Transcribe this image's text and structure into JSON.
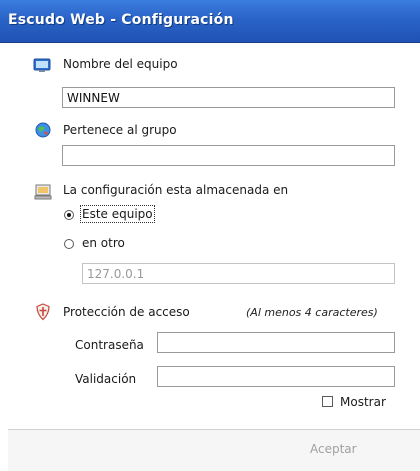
{
  "window": {
    "title": "Escudo Web - Configuración"
  },
  "computer": {
    "label": "Nombre del equipo",
    "value": "WINNEW",
    "icon": "computer-icon"
  },
  "group": {
    "label": "Pertenece al grupo",
    "value": "",
    "icon": "network-globe-icon"
  },
  "storage": {
    "label": "La configuración esta almacenada en",
    "icon": "desktop-monitor-icon",
    "options": [
      {
        "label": "Este equipo",
        "selected": true
      },
      {
        "label": "en otro",
        "selected": false
      }
    ],
    "remote_value": "127.0.0.1"
  },
  "access": {
    "label": "Protección de acceso",
    "hint": "(Al menos 4 caracteres)",
    "icon": "shield-icon",
    "password_label": "Contraseña",
    "password_value": "",
    "validation_label": "Validación",
    "validation_value": "",
    "show_label": "Mostrar",
    "show_checked": false
  },
  "footer": {
    "accept_label": "Aceptar"
  }
}
